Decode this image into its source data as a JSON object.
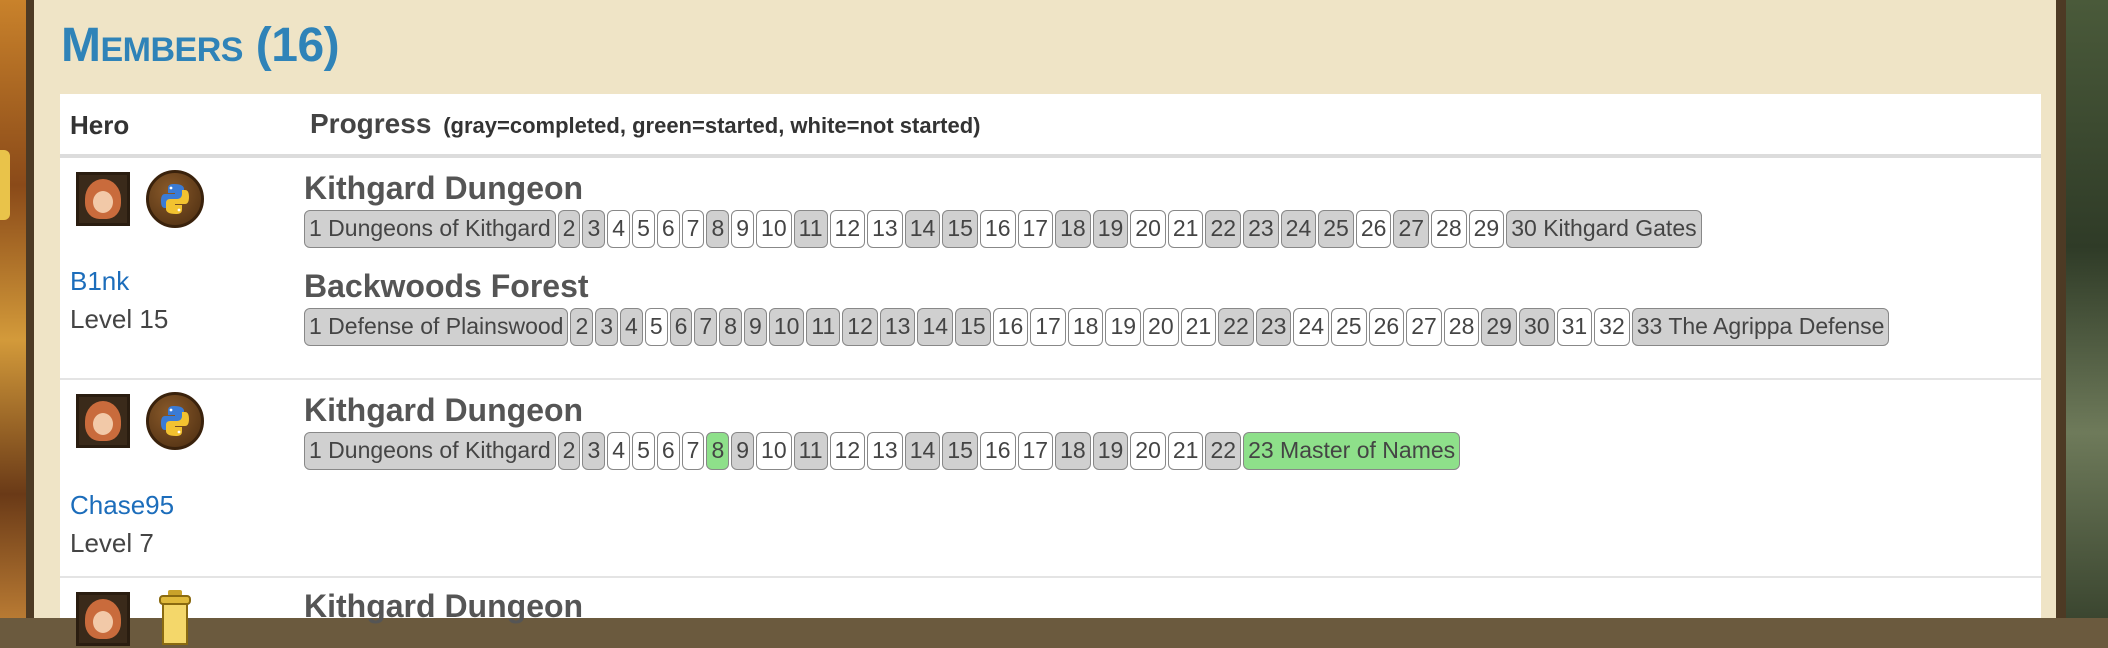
{
  "heading": "Members (16)",
  "table": {
    "col_hero": "Hero",
    "col_progress": "Progress",
    "progress_note": "(gray=completed, green=started, white=not started)"
  },
  "members": [
    {
      "name": "B1nk",
      "level": "Level 15",
      "language_icon": "python-icon",
      "campaigns": [
        {
          "title": "Kithgard Dungeon",
          "levels": [
            {
              "label": "1 Dungeons of Kithgard",
              "state": "completed"
            },
            {
              "label": "2",
              "state": "completed"
            },
            {
              "label": "3",
              "state": "completed"
            },
            {
              "label": "4",
              "state": "not_started"
            },
            {
              "label": "5",
              "state": "not_started"
            },
            {
              "label": "6",
              "state": "not_started"
            },
            {
              "label": "7",
              "state": "not_started"
            },
            {
              "label": "8",
              "state": "completed"
            },
            {
              "label": "9",
              "state": "not_started"
            },
            {
              "label": "10",
              "state": "not_started"
            },
            {
              "label": "11",
              "state": "completed"
            },
            {
              "label": "12",
              "state": "not_started"
            },
            {
              "label": "13",
              "state": "not_started"
            },
            {
              "label": "14",
              "state": "completed"
            },
            {
              "label": "15",
              "state": "completed"
            },
            {
              "label": "16",
              "state": "not_started"
            },
            {
              "label": "17",
              "state": "not_started"
            },
            {
              "label": "18",
              "state": "completed"
            },
            {
              "label": "19",
              "state": "completed"
            },
            {
              "label": "20",
              "state": "not_started"
            },
            {
              "label": "21",
              "state": "not_started"
            },
            {
              "label": "22",
              "state": "completed"
            },
            {
              "label": "23",
              "state": "completed"
            },
            {
              "label": "24",
              "state": "completed"
            },
            {
              "label": "25",
              "state": "completed"
            },
            {
              "label": "26",
              "state": "not_started"
            },
            {
              "label": "27",
              "state": "completed"
            },
            {
              "label": "28",
              "state": "not_started"
            },
            {
              "label": "29",
              "state": "not_started"
            },
            {
              "label": "30 Kithgard Gates",
              "state": "completed"
            }
          ]
        },
        {
          "title": "Backwoods Forest",
          "levels": [
            {
              "label": "1 Defense of Plainswood",
              "state": "completed"
            },
            {
              "label": "2",
              "state": "completed"
            },
            {
              "label": "3",
              "state": "completed"
            },
            {
              "label": "4",
              "state": "completed"
            },
            {
              "label": "5",
              "state": "not_started"
            },
            {
              "label": "6",
              "state": "completed"
            },
            {
              "label": "7",
              "state": "completed"
            },
            {
              "label": "8",
              "state": "completed"
            },
            {
              "label": "9",
              "state": "completed"
            },
            {
              "label": "10",
              "state": "completed"
            },
            {
              "label": "11",
              "state": "completed"
            },
            {
              "label": "12",
              "state": "completed"
            },
            {
              "label": "13",
              "state": "completed"
            },
            {
              "label": "14",
              "state": "completed"
            },
            {
              "label": "15",
              "state": "completed"
            },
            {
              "label": "16",
              "state": "not_started"
            },
            {
              "label": "17",
              "state": "not_started"
            },
            {
              "label": "18",
              "state": "not_started"
            },
            {
              "label": "19",
              "state": "not_started"
            },
            {
              "label": "20",
              "state": "not_started"
            },
            {
              "label": "21",
              "state": "not_started"
            },
            {
              "label": "22",
              "state": "completed"
            },
            {
              "label": "23",
              "state": "completed"
            },
            {
              "label": "24",
              "state": "not_started"
            },
            {
              "label": "25",
              "state": "not_started"
            },
            {
              "label": "26",
              "state": "not_started"
            },
            {
              "label": "27",
              "state": "not_started"
            },
            {
              "label": "28",
              "state": "not_started"
            },
            {
              "label": "29",
              "state": "completed"
            },
            {
              "label": "30",
              "state": "completed"
            },
            {
              "label": "31",
              "state": "not_started"
            },
            {
              "label": "32",
              "state": "not_started"
            },
            {
              "label": "33 The Agrippa Defense",
              "state": "completed"
            }
          ]
        }
      ]
    },
    {
      "name": "Chase95",
      "level": "Level 7",
      "language_icon": "python-icon",
      "campaigns": [
        {
          "title": "Kithgard Dungeon",
          "levels": [
            {
              "label": "1 Dungeons of Kithgard",
              "state": "completed"
            },
            {
              "label": "2",
              "state": "completed"
            },
            {
              "label": "3",
              "state": "completed"
            },
            {
              "label": "4",
              "state": "not_started"
            },
            {
              "label": "5",
              "state": "not_started"
            },
            {
              "label": "6",
              "state": "not_started"
            },
            {
              "label": "7",
              "state": "not_started"
            },
            {
              "label": "8",
              "state": "started"
            },
            {
              "label": "9",
              "state": "completed"
            },
            {
              "label": "10",
              "state": "not_started"
            },
            {
              "label": "11",
              "state": "completed"
            },
            {
              "label": "12",
              "state": "not_started"
            },
            {
              "label": "13",
              "state": "not_started"
            },
            {
              "label": "14",
              "state": "completed"
            },
            {
              "label": "15",
              "state": "completed"
            },
            {
              "label": "16",
              "state": "not_started"
            },
            {
              "label": "17",
              "state": "not_started"
            },
            {
              "label": "18",
              "state": "completed"
            },
            {
              "label": "19",
              "state": "completed"
            },
            {
              "label": "20",
              "state": "not_started"
            },
            {
              "label": "21",
              "state": "not_started"
            },
            {
              "label": "22",
              "state": "completed"
            },
            {
              "label": "23 Master of Names",
              "state": "started"
            }
          ]
        }
      ]
    },
    {
      "name": "",
      "level": "",
      "language_icon": "lantern-icon",
      "campaigns": [
        {
          "title": "Kithgard Dungeon",
          "levels": []
        }
      ]
    }
  ],
  "colors": {
    "heading": "#2f83b8",
    "completed": "#d0d0d0",
    "started": "#8ee08a",
    "not_started": "#ffffff",
    "link": "#1c6dbb"
  }
}
